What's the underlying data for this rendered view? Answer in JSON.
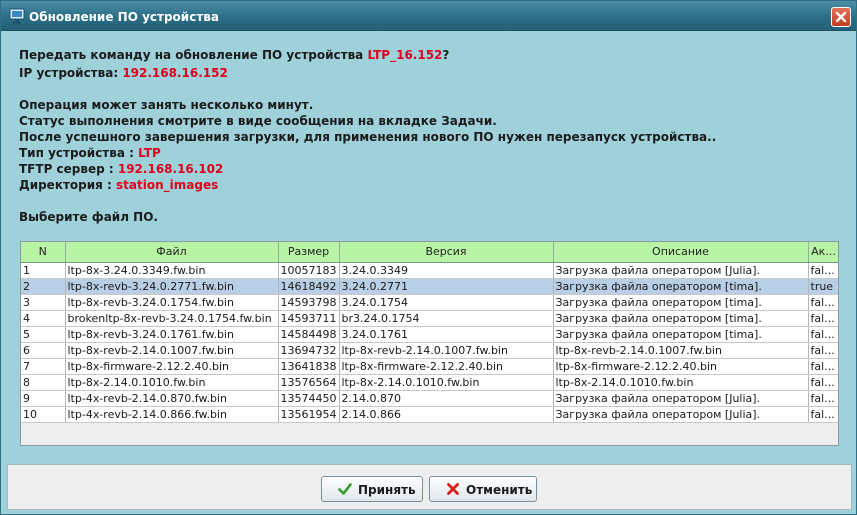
{
  "window": {
    "title": "Обновление ПО устройства"
  },
  "info": {
    "line1_prefix": "Передать команду на обновление ПО устройства ",
    "device_name": "LTP_16.152",
    "line1_suffix": "?",
    "ip_label": "IP устройства: ",
    "ip_value": "192.168.16.152",
    "msg1": "Операция может занять несколько минут.",
    "msg2": "Статус выполнения смотрите в виде сообщения на вкладке Задачи.",
    "msg3": "После успешного завершения загрузки, для применения нового ПО нужен перезапуск устройства..",
    "type_label": "Тип устройства : ",
    "type_value": "LTP",
    "tftp_label": "TFTP сервер : ",
    "tftp_value": "192.168.16.102",
    "dir_label": "Директория : ",
    "dir_value": "station_images",
    "choose": "Выберите файл ПО."
  },
  "table": {
    "headers": [
      "N",
      "Файл",
      "Размер",
      "Версия",
      "Описание",
      "Ак..."
    ],
    "rows": [
      [
        "1",
        "ltp-8x-3.24.0.3349.fw.bin",
        "10057183",
        "3.24.0.3349",
        "Загрузка файла оператором [Julia].",
        "fal..."
      ],
      [
        "2",
        "ltp-8x-revb-3.24.0.2771.fw.bin",
        "14618492",
        "3.24.0.2771",
        "Загрузка файла оператором [tima].",
        "true"
      ],
      [
        "3",
        "ltp-8x-revb-3.24.0.1754.fw.bin",
        "14593798",
        "3.24.0.1754",
        "Загрузка файла оператором [tima].",
        "fal..."
      ],
      [
        "4",
        "brokenltp-8x-revb-3.24.0.1754.fw.bin",
        "14593711",
        "br3.24.0.1754",
        "Загрузка файла оператором [tima].",
        "fal..."
      ],
      [
        "5",
        "ltp-8x-revb-3.24.0.1761.fw.bin",
        "14584498",
        "3.24.0.1761",
        "Загрузка файла оператором [tima].",
        "fal..."
      ],
      [
        "6",
        "ltp-8x-revb-2.14.0.1007.fw.bin",
        "13694732",
        "ltp-8x-revb-2.14.0.1007.fw.bin",
        "ltp-8x-revb-2.14.0.1007.fw.bin",
        "fal..."
      ],
      [
        "7",
        "ltp-8x-firmware-2.12.2.40.bin",
        "13641838",
        "ltp-8x-firmware-2.12.2.40.bin",
        "ltp-8x-firmware-2.12.2.40.bin",
        "fal..."
      ],
      [
        "8",
        "ltp-8x-2.14.0.1010.fw.bin",
        "13576564",
        "ltp-8x-2.14.0.1010.fw.bin",
        "ltp-8x-2.14.0.1010.fw.bin",
        "fal..."
      ],
      [
        "9",
        "ltp-4x-revb-2.14.0.870.fw.bin",
        "13574450",
        "2.14.0.870",
        "Загрузка файла оператором [Julia].",
        "fal..."
      ],
      [
        "10",
        "ltp-4x-revb-2.14.0.866.fw.bin",
        "13561954",
        "2.14.0.866",
        "Загрузка файла оператором [Julia].",
        "fal..."
      ]
    ],
    "selected_row": 2
  },
  "buttons": {
    "accept": "Принять",
    "cancel": "Отменить"
  },
  "icons": {
    "app": "monitor-icon",
    "close": "close-icon",
    "accept": "checkmark-icon",
    "cancel": "cross-icon"
  },
  "colors": {
    "background": "#9ed1da",
    "title_bar": "#2c6e88",
    "highlight_text": "#e0001c",
    "table_header": "#b9f4a6",
    "selected_row": "#b8cfe5"
  }
}
